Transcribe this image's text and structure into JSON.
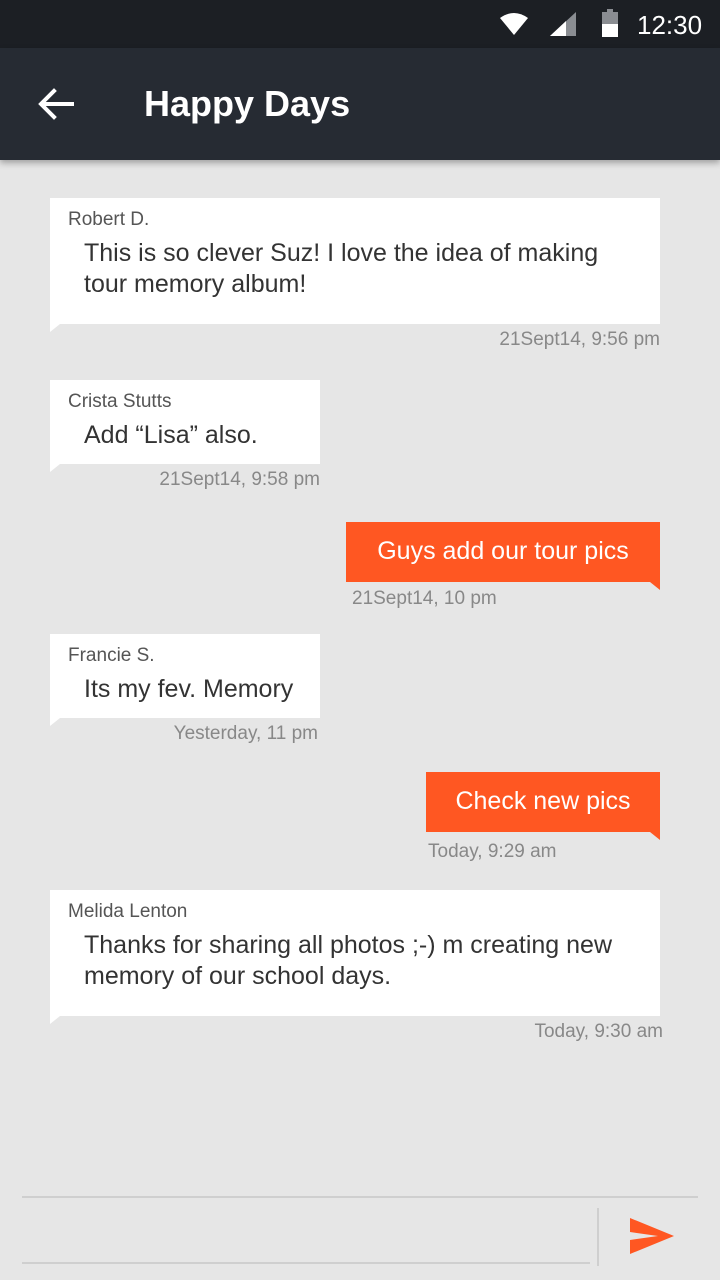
{
  "status_bar": {
    "time": "12:30",
    "icons": [
      "wifi-icon",
      "signal-icon",
      "battery-icon"
    ]
  },
  "app_bar": {
    "title": "Happy Days",
    "back_icon": "arrow-left-icon"
  },
  "messages": [
    {
      "direction": "incoming",
      "sender": "Robert D.",
      "text": "This is so clever Suz! I love the idea of making tour memory album!",
      "timestamp": "21Sept14, 9:56 pm"
    },
    {
      "direction": "incoming",
      "sender": "Crista Stutts",
      "text": "Add “Lisa” also.",
      "timestamp": "21Sept14, 9:58 pm"
    },
    {
      "direction": "outgoing",
      "text": "Guys add our tour pics",
      "timestamp": "21Sept14, 10 pm"
    },
    {
      "direction": "incoming",
      "sender": "Francie S.",
      "text": "Its my fev. Memory",
      "timestamp": "Yesterday, 11 pm"
    },
    {
      "direction": "outgoing",
      "text": "Check new pics",
      "timestamp": "Today, 9:29 am"
    },
    {
      "direction": "incoming",
      "sender": "Melida Lenton",
      "text": "Thanks for sharing all photos ;-) m creating new memory of our school days.",
      "timestamp": "Today, 9:30 am"
    }
  ],
  "composer": {
    "value": "",
    "send_icon": "send-icon"
  },
  "colors": {
    "status_bar_bg": "#1c1f24",
    "app_bar_bg": "#262b33",
    "background": "#e6e6e6",
    "outgoing_bubble": "#ff5722",
    "incoming_bubble": "#ffffff"
  }
}
